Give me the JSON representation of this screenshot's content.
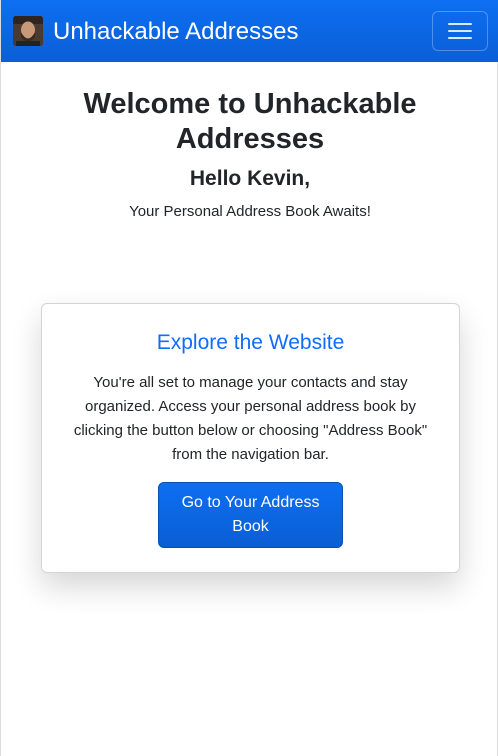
{
  "navbar": {
    "brand": "Unhackable Addresses",
    "avatar_icon": "user-avatar",
    "toggler_icon": "hamburger-menu-icon",
    "color": "#0d6efd"
  },
  "hero": {
    "title": "Welcome to Unhackable Addresses",
    "greeting": "Hello Kevin,",
    "subtitle": "Your Personal Address Book Awaits!"
  },
  "card": {
    "title": "Explore the Website",
    "text": "You're all set to manage your contacts and stay organized. Access your personal address book by clicking the button below or choosing \"Address Book\" from the navigation bar.",
    "button_label": "Go to Your Address Book"
  },
  "colors": {
    "accent": "#0d6efd",
    "text": "#212529"
  }
}
